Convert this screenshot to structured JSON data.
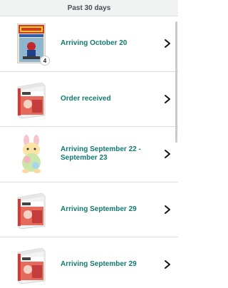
{
  "header": {
    "title": "Past 30 days"
  },
  "orders": [
    {
      "status": "Arriving October 20",
      "image": "comic-book-icon",
      "quantity": "4"
    },
    {
      "status": "Order received",
      "image": "card-box-icon"
    },
    {
      "status": "Arriving September 22 - September 23",
      "image": "plush-toy-icon"
    },
    {
      "status": "Arriving September 29",
      "image": "card-box-icon"
    },
    {
      "status": "Arriving September 29",
      "image": "card-box-icon"
    }
  ],
  "colors": {
    "status_text": "#107a70",
    "header_bg": "#f1f2f2"
  }
}
